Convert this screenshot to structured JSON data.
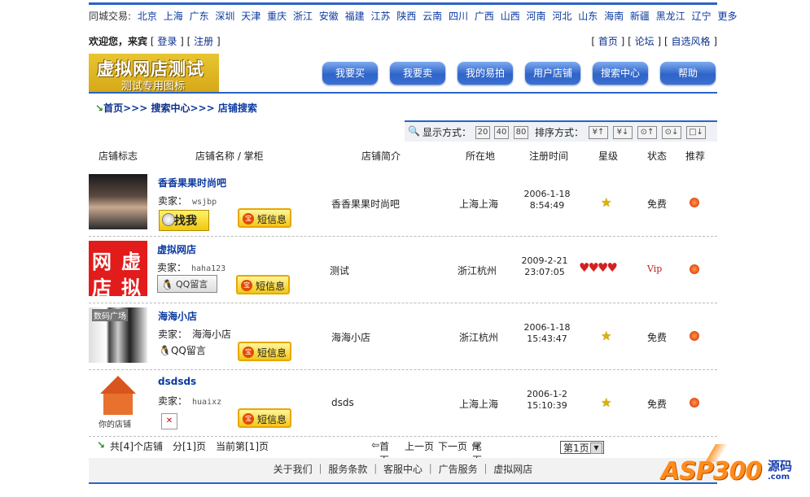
{
  "citybar": {
    "label": "同城交易:",
    "cities": [
      "北京",
      "上海",
      "广东",
      "深圳",
      "天津",
      "重庆",
      "浙江",
      "安徽",
      "福建",
      "江苏",
      "陕西",
      "云南",
      "四川",
      "广西",
      "山西",
      "河南",
      "河北",
      "山东",
      "海南",
      "新疆",
      "黑龙江",
      "辽宁",
      "更多"
    ]
  },
  "welcome": {
    "greeting": "欢迎您，来宾",
    "login": "登录",
    "register": "注册",
    "home": "首页",
    "forum": "论坛",
    "style": "自选风格"
  },
  "logo": {
    "title": "虚拟网店测试",
    "subtitle": "测试专用图标"
  },
  "nav": [
    "我要买",
    "我要卖",
    "我的易拍",
    "用户店铺",
    "搜索中心",
    "帮助"
  ],
  "breadcrumb": {
    "home": "首页",
    "search": "搜索中心",
    "current": "店铺搜索",
    "sep": ">>>"
  },
  "sortbar": {
    "display_label": "显示方式：",
    "display_options": [
      "20",
      "40",
      "80"
    ],
    "sort_label": "排序方式：",
    "sort_icons": [
      "¥↑",
      "¥↓",
      "⊙↑",
      "⊙↓",
      "□↓"
    ]
  },
  "columns": [
    "店铺标志",
    "店铺名称 / 掌柜",
    "店铺简介",
    "所在地",
    "注册时间",
    "星级",
    "状态",
    "推荐"
  ],
  "seller_label": "卖家：",
  "shops": [
    {
      "name": "香香果果时尚吧",
      "seller": "wsjbp",
      "intro": "香香果果时尚吧",
      "location": "上海上海",
      "date": "2006-1-18",
      "time": "8:54:49",
      "rating": "star",
      "status": "免费",
      "button1": "找我",
      "msg": "短信息"
    },
    {
      "name": "虚拟网店",
      "seller": "haha123",
      "intro": "测试",
      "location": "浙江杭州",
      "date": "2009-2-21",
      "time": "23:07:05",
      "rating": "hearts",
      "status": "Vip",
      "button1": "QQ留言",
      "msg": "短信息",
      "thumb_text": [
        "网",
        "虚",
        "店",
        "拟"
      ]
    },
    {
      "name": "海海小店",
      "seller": "海海小店",
      "intro": "海海小店",
      "location": "浙江杭州",
      "date": "2006-1-18",
      "time": "15:43:47",
      "rating": "star",
      "status": "免费",
      "button1": "QQ留言",
      "msg": "短信息",
      "thumb_text": [
        "数码广场"
      ]
    },
    {
      "name": "dsdsds",
      "seller": "huaixz",
      "intro": "dsds",
      "location": "上海上海",
      "date": "2006-1-2",
      "time": "15:10:39",
      "rating": "star",
      "status": "免费",
      "button1": "",
      "msg": "短信息",
      "thumb_text": [
        "你的店铺"
      ]
    }
  ],
  "pagination": {
    "summary": "共[4]个店铺　分[1]页　当前第[1]页",
    "first": "首页",
    "prev": "上一页",
    "next": "下一页",
    "last": "尾页",
    "select": "第1页"
  },
  "footer": [
    "关于我们",
    "服务条款",
    "客服中心",
    "广告服务",
    "虚拟网店"
  ],
  "watermark": {
    "brand": "ASP300",
    "tag": "源码",
    "domain": ".com"
  }
}
